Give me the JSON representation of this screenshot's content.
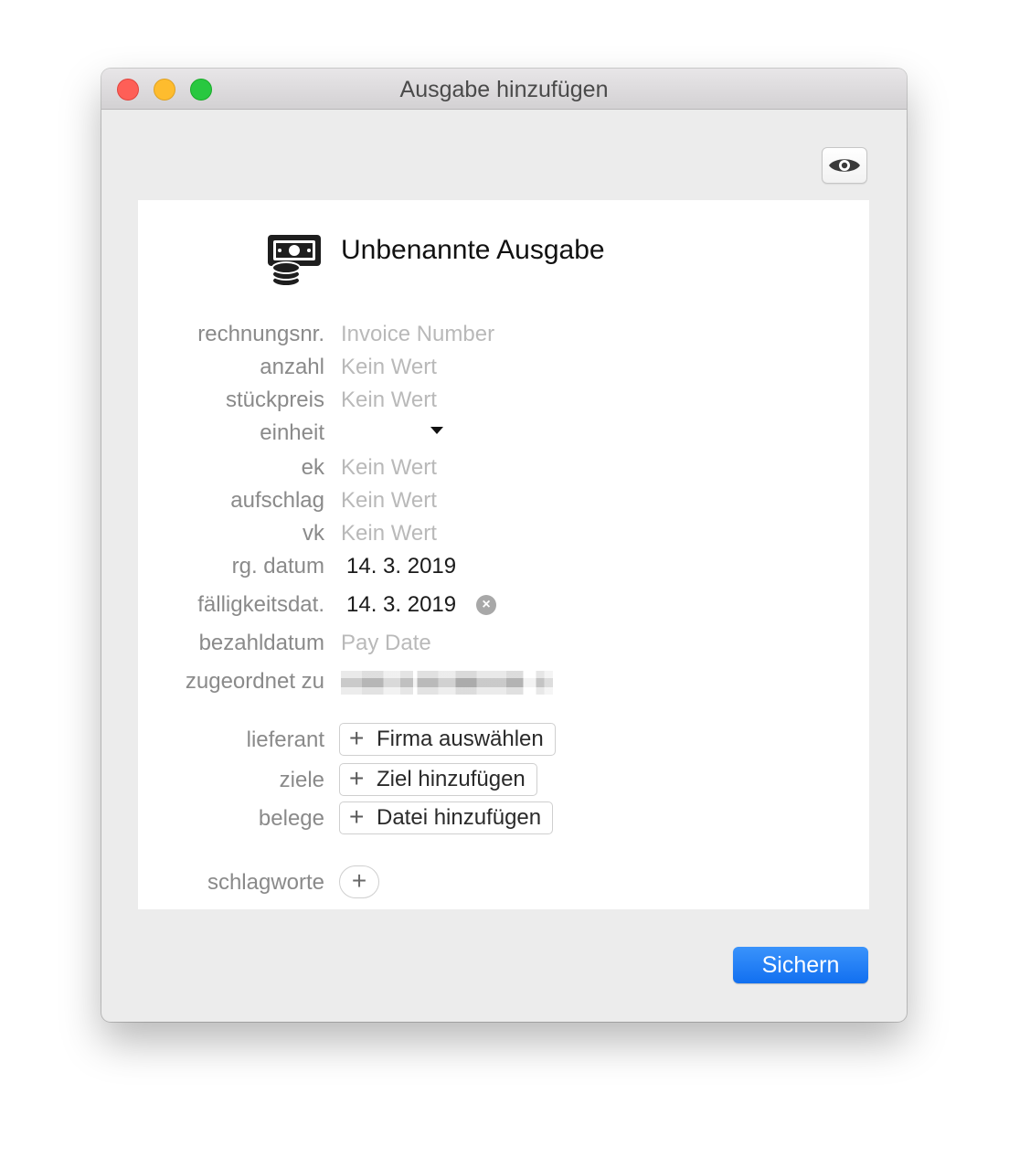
{
  "window": {
    "title": "Ausgabe hinzufügen",
    "controls": [
      "close",
      "minimize",
      "zoom"
    ]
  },
  "toolbar": {
    "preview_icon": "eye-icon"
  },
  "document": {
    "icon": "money-coins-icon",
    "title": "Unbenannte Ausgabe"
  },
  "fields": {
    "invoice_number": {
      "label": "rechnungsnr.",
      "placeholder": "Invoice Number"
    },
    "quantity": {
      "label": "anzahl",
      "placeholder": "Kein Wert"
    },
    "unit_price": {
      "label": "stückpreis",
      "placeholder": "Kein Wert"
    },
    "unit": {
      "label": "einheit",
      "value": ""
    },
    "ek": {
      "label": "ek",
      "placeholder": "Kein Wert"
    },
    "markup": {
      "label": "aufschlag",
      "placeholder": "Kein Wert"
    },
    "vk": {
      "label": "vk",
      "placeholder": "Kein Wert"
    },
    "invoice_date": {
      "label": "rg. datum",
      "value": "14.  3. 2019"
    },
    "due_date": {
      "label": "fälligkeitsdat.",
      "value": "14.  3. 2019"
    },
    "paid_date": {
      "label": "bezahldatum",
      "placeholder": "Pay Date"
    },
    "assigned_to": {
      "label": "zugeordnet zu"
    }
  },
  "relations": {
    "supplier": {
      "label": "lieferant",
      "button": "Firma auswählen"
    },
    "goals": {
      "label": "ziele",
      "button": "Ziel hinzufügen"
    },
    "receipts": {
      "label": "belege",
      "button": "Datei hinzufügen"
    },
    "tags": {
      "label": "schlagworte"
    }
  },
  "actions": {
    "save": "Sichern"
  },
  "colors": {
    "accent": "#1a78f2",
    "window_bg": "#ececec"
  }
}
